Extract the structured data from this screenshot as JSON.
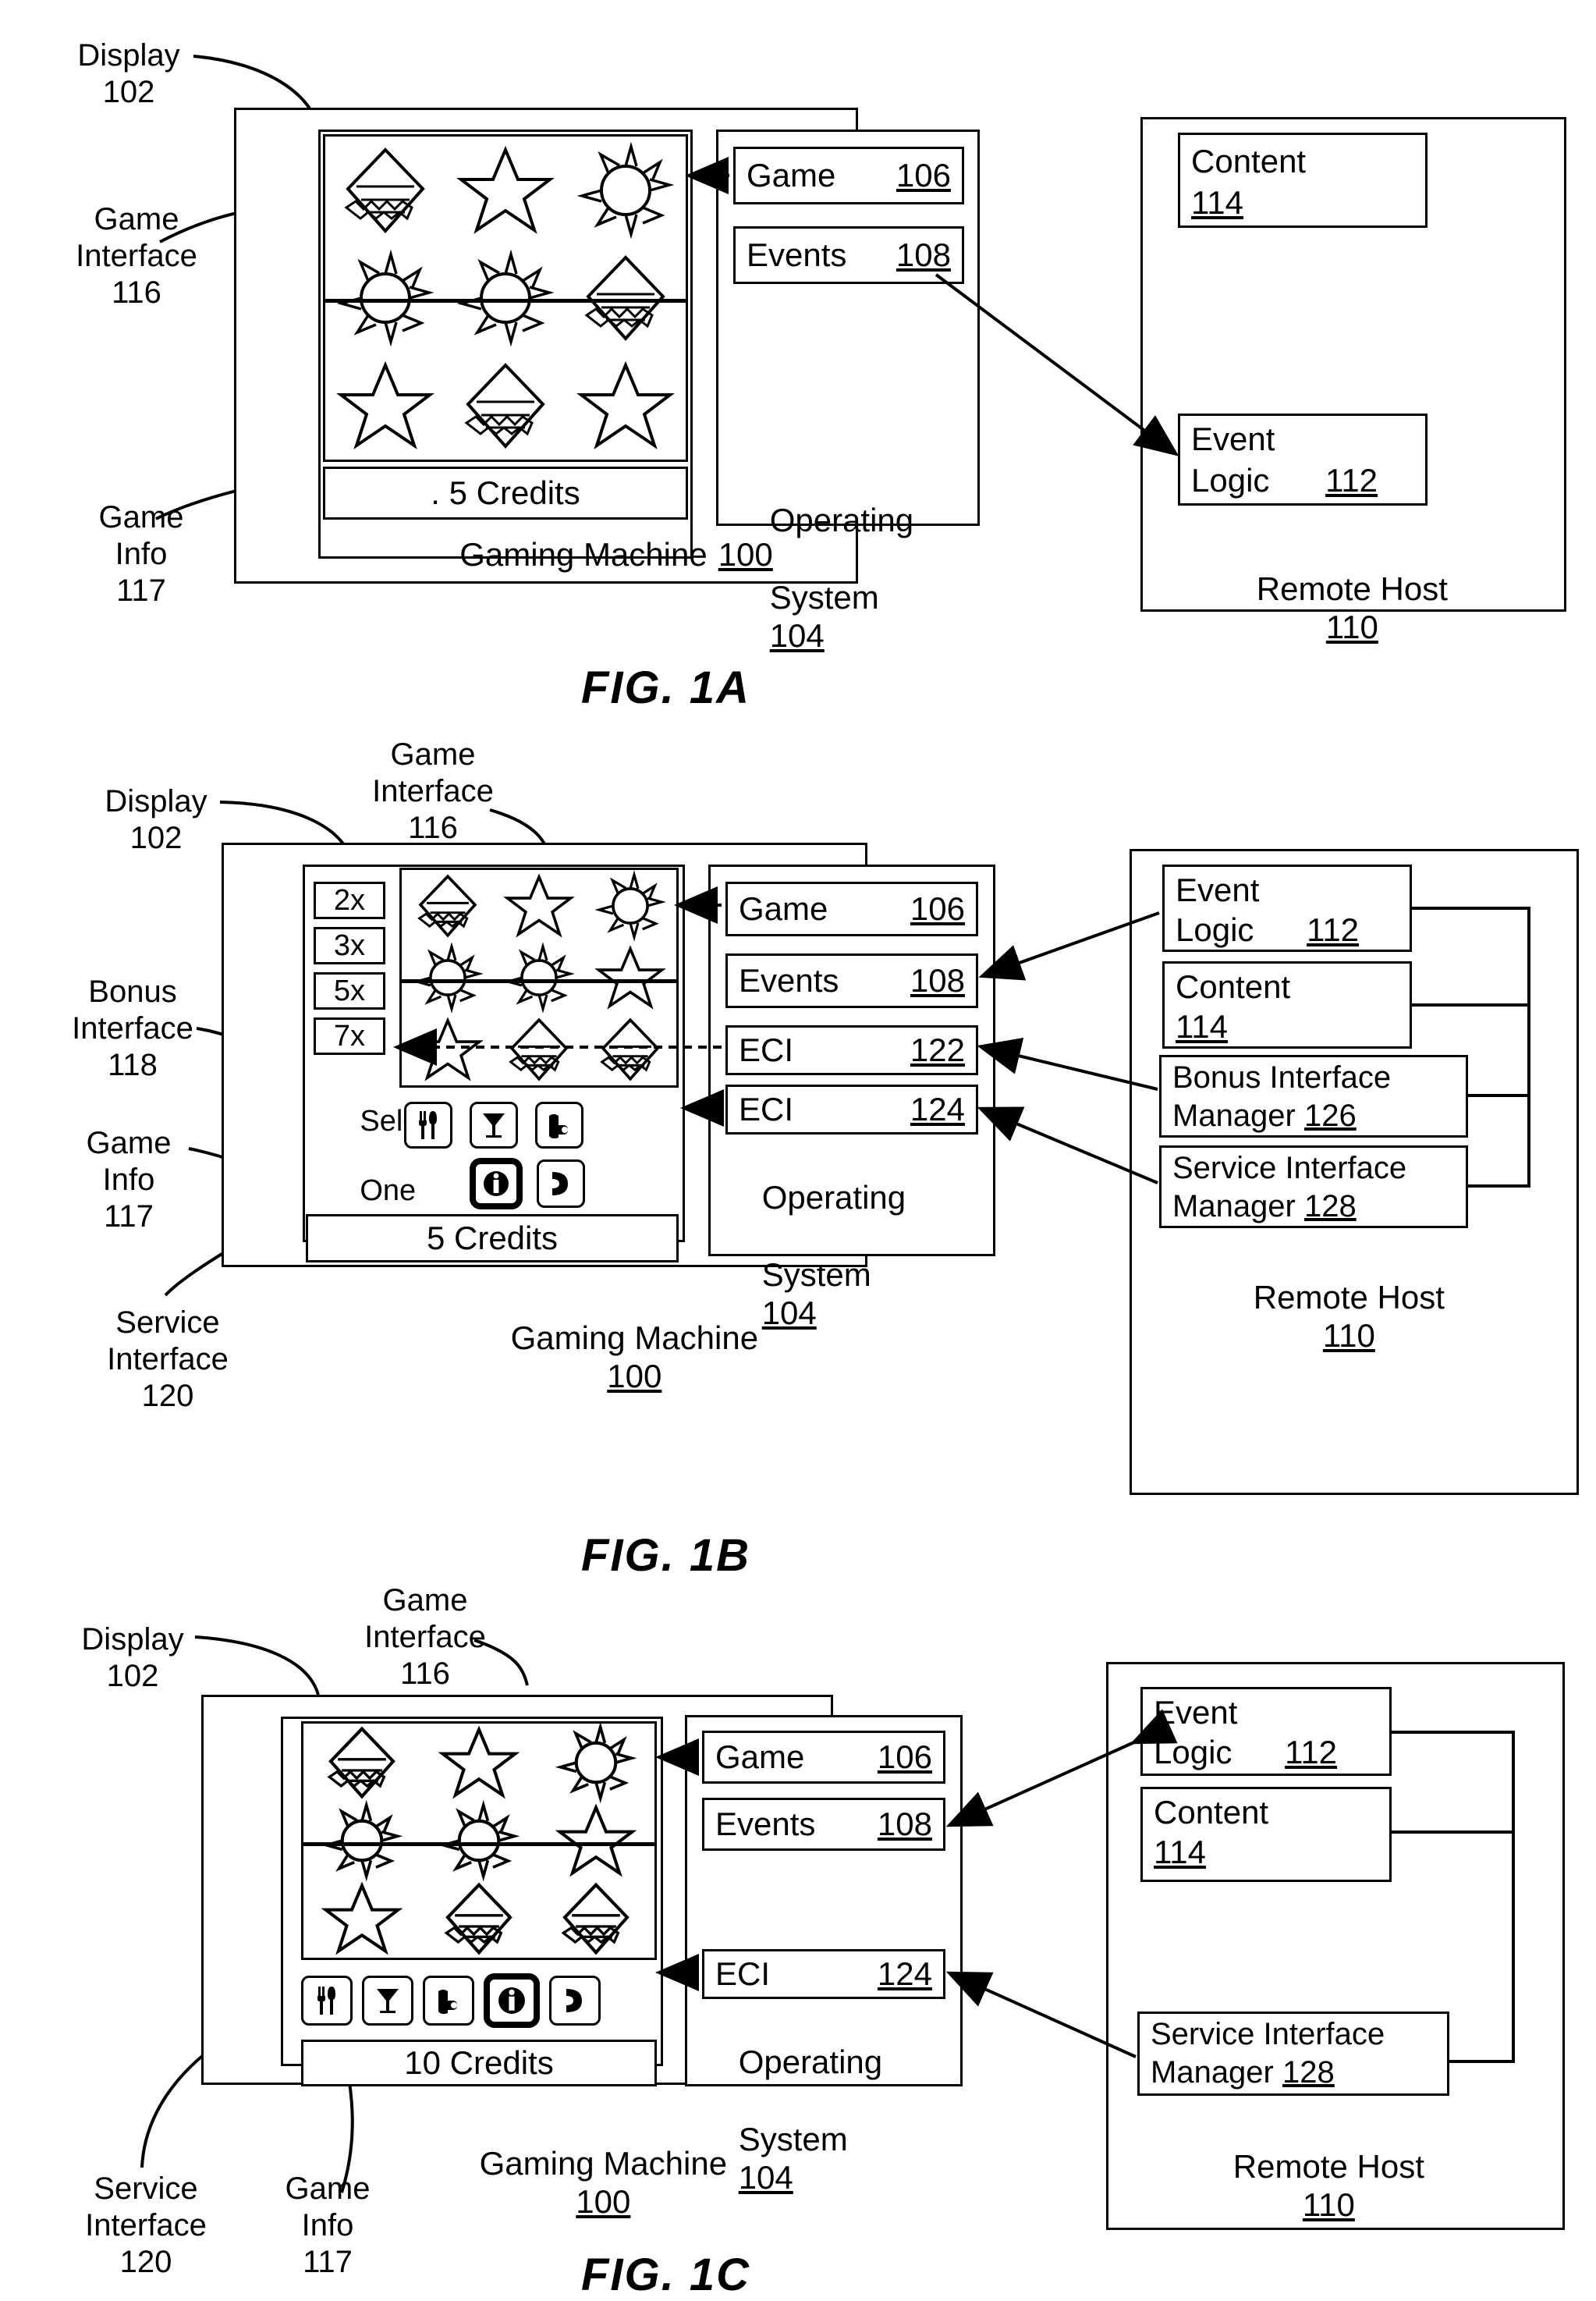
{
  "figures": [
    {
      "caption": "FIG. 1A",
      "callouts": [
        {
          "name": "display",
          "text": "Display\n102"
        },
        {
          "name": "game-interface",
          "text": "Game\nInterface\n116"
        },
        {
          "name": "game-info",
          "text": "Game\nInfo\n117"
        }
      ],
      "gaming_machine_label": "Gaming Machine 100",
      "gaming_machine_ref": "100",
      "credits": ". 5 Credits",
      "os_label": "Operating\nSystem 104",
      "os_ref": "104",
      "modules": [
        {
          "name": "game",
          "label": "Game",
          "ref": "106"
        },
        {
          "name": "events",
          "label": "Events",
          "ref": "108"
        }
      ],
      "remote_host_label": "Remote Host 110",
      "remote_host_ref": "110",
      "host_modules": [
        {
          "name": "content",
          "label": "Content",
          "ref": "114"
        },
        {
          "name": "event-logic",
          "label": "Event\nLogic",
          "ref": "112"
        }
      ],
      "reel_symbols": [
        [
          "diamond",
          "star",
          "sun"
        ],
        [
          "sun",
          "sun",
          "diamond"
        ],
        [
          "star",
          "diamond",
          "star"
        ]
      ]
    },
    {
      "caption": "FIG. 1B",
      "callouts": [
        {
          "name": "display",
          "text": "Display\n102"
        },
        {
          "name": "game-interface",
          "text": "Game\nInterface\n116"
        },
        {
          "name": "bonus-interface",
          "text": "Bonus\nInterface\n118"
        },
        {
          "name": "game-info",
          "text": "Game\nInfo\n117"
        },
        {
          "name": "service-interface",
          "text": "Service\nInterface\n120"
        }
      ],
      "gaming_machine_label": "Gaming Machine 100",
      "gaming_machine_ref": "100",
      "credits": "5 Credits",
      "os_label": "Operating\nSystem 104",
      "os_ref": "104",
      "bonus_options": [
        "2x",
        "3x",
        "5x",
        "7x"
      ],
      "bonus_prompt": "Select\nOne",
      "modules": [
        {
          "name": "game",
          "label": "Game",
          "ref": "106"
        },
        {
          "name": "events",
          "label": "Events",
          "ref": "108"
        },
        {
          "name": "eci-122",
          "label": "ECI",
          "ref": "122"
        },
        {
          "name": "eci-124",
          "label": "ECI",
          "ref": "124"
        }
      ],
      "remote_host_label": "Remote Host 110",
      "remote_host_ref": "110",
      "host_modules": [
        {
          "name": "event-logic",
          "label": "Event\nLogic",
          "ref": "112"
        },
        {
          "name": "content",
          "label": "Content",
          "ref": "114"
        },
        {
          "name": "bonus-interface-manager",
          "label": "Bonus Interface\nManager 126",
          "ref": "126"
        },
        {
          "name": "service-interface-manager",
          "label": "Service Interface\nManager 128",
          "ref": "128"
        }
      ],
      "reel_symbols": [
        [
          "diamond",
          "star",
          "sun"
        ],
        [
          "sun",
          "sun",
          "star"
        ],
        [
          "star",
          "diamond",
          "diamond"
        ]
      ],
      "service_icons_row1": [
        "cutlery-icon",
        "cocktail-icon",
        "hand-attendant-icon"
      ],
      "service_icons_row2": [
        "info-icon",
        "phone-icon"
      ],
      "service_icons_highlighted": [
        "info-icon"
      ]
    },
    {
      "caption": "FIG. 1C",
      "callouts": [
        {
          "name": "display",
          "text": "Display\n102"
        },
        {
          "name": "game-interface",
          "text": "Game\nInterface\n116"
        },
        {
          "name": "service-interface",
          "text": "Service\nInterface\n120"
        },
        {
          "name": "game-info",
          "text": "Game\nInfo\n117"
        }
      ],
      "gaming_machine_label": "Gaming Machine 100",
      "gaming_machine_ref": "100",
      "credits": "10 Credits",
      "os_label": "Operating\nSystem 104",
      "os_ref": "104",
      "modules": [
        {
          "name": "game",
          "label": "Game",
          "ref": "106"
        },
        {
          "name": "events",
          "label": "Events",
          "ref": "108"
        },
        {
          "name": "eci-124",
          "label": "ECI",
          "ref": "124"
        }
      ],
      "remote_host_label": "Remote Host 110",
      "remote_host_ref": "110",
      "host_modules": [
        {
          "name": "event-logic",
          "label": "Event\nLogic",
          "ref": "112"
        },
        {
          "name": "content",
          "label": "Content",
          "ref": "114"
        },
        {
          "name": "service-interface-manager",
          "label": "Service Interface\nManager 128",
          "ref": "128"
        }
      ],
      "reel_symbols": [
        [
          "diamond",
          "star",
          "sun"
        ],
        [
          "sun",
          "sun",
          "star"
        ],
        [
          "star",
          "diamond",
          "diamond"
        ]
      ],
      "service_icons_row1": [
        "cutlery-icon",
        "cocktail-icon",
        "hand-attendant-icon",
        "info-icon",
        "phone-icon"
      ],
      "service_icons_highlighted": [
        "info-icon"
      ]
    }
  ],
  "figA": {
    "caption": "FIG. 1A",
    "display_callout": "Display\n102",
    "game_interface_callout": "Game\nInterface\n116",
    "game_info_callout": "Game\nInfo\n117",
    "credits": ". 5 Credits",
    "game_label": "Game",
    "game_ref": "106",
    "events_label": "Events",
    "events_ref": "108",
    "os_line1": "Operating",
    "os_line2": "System",
    "os_ref": "104",
    "gm_label": "Gaming Machine",
    "gm_ref": "100",
    "content_label": "Content",
    "content_ref": "114",
    "event_logic_l1": "Event",
    "event_logic_l2": "Logic",
    "event_logic_ref": "112",
    "rh_label": "Remote Host",
    "rh_ref": "110"
  },
  "figB": {
    "caption": "FIG. 1B",
    "display_callout": "Display\n102",
    "game_interface_callout": "Game\nInterface\n116",
    "bonus_callout": "Bonus\nInterface\n118",
    "game_info_callout": "Game\nInfo\n117",
    "service_callout": "Service\nInterface\n120",
    "credits": "5 Credits",
    "mult1": "2x",
    "mult2": "3x",
    "mult3": "5x",
    "mult4": "7x",
    "select_l1": "Select",
    "select_l2": "One",
    "game_label": "Game",
    "game_ref": "106",
    "events_label": "Events",
    "events_ref": "108",
    "eci1_label": "ECI",
    "eci1_ref": "122",
    "eci2_label": "ECI",
    "eci2_ref": "124",
    "os_line1": "Operating",
    "os_line2": "System",
    "os_ref": "104",
    "gm_label": "Gaming Machine",
    "gm_ref": "100",
    "event_logic_l1": "Event",
    "event_logic_l2": "Logic",
    "event_logic_ref": "112",
    "content_label": "Content",
    "content_ref": "114",
    "bim_l1": "Bonus Interface",
    "bim_l2": "Manager",
    "bim_ref": "126",
    "sim_l1": "Service Interface",
    "sim_l2": "Manager",
    "sim_ref": "128",
    "rh_label": "Remote Host",
    "rh_ref": "110"
  },
  "figC": {
    "caption": "FIG. 1C",
    "display_callout": "Display\n102",
    "game_interface_callout": "Game\nInterface\n116",
    "service_callout": "Service\nInterface\n120",
    "game_info_callout": "Game\nInfo\n117",
    "credits": "10 Credits",
    "game_label": "Game",
    "game_ref": "106",
    "events_label": "Events",
    "events_ref": "108",
    "eci_label": "ECI",
    "eci_ref": "124",
    "os_line1": "Operating",
    "os_line2": "System",
    "os_ref": "104",
    "gm_label": "Gaming Machine",
    "gm_ref": "100",
    "event_logic_l1": "Event",
    "event_logic_l2": "Logic",
    "event_logic_ref": "112",
    "content_label": "Content",
    "content_ref": "114",
    "sim_l1": "Service Interface",
    "sim_l2": "Manager",
    "sim_ref": "128",
    "rh_label": "Remote Host",
    "rh_ref": "110"
  }
}
